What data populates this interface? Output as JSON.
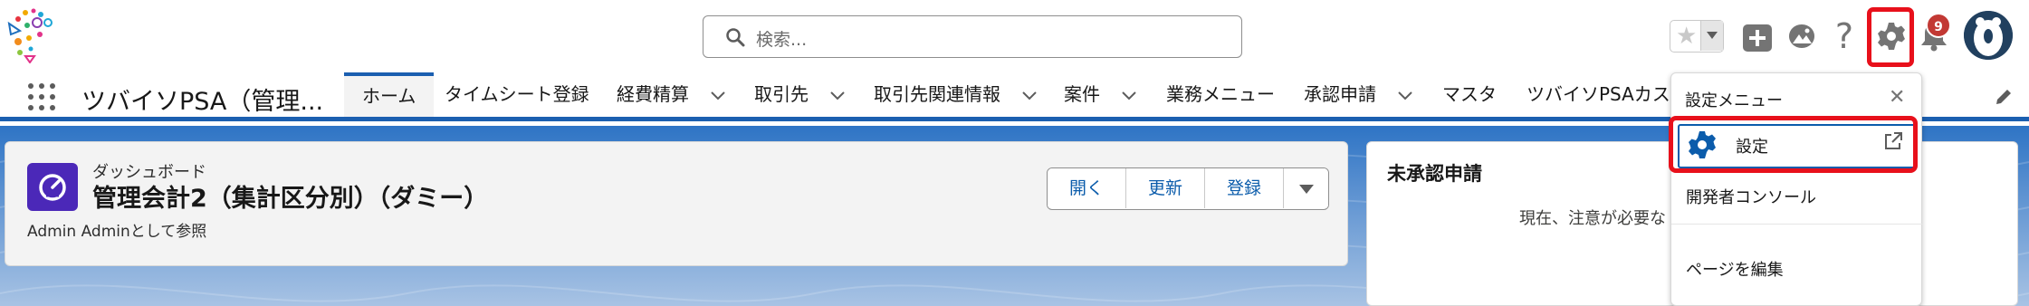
{
  "search": {
    "placeholder": "検索..."
  },
  "header": {
    "notifications_count": "9"
  },
  "nav": {
    "app_name": "ツバイソPSA（管理...",
    "tabs": [
      {
        "label": "ホーム",
        "active": true,
        "dropdown": false
      },
      {
        "label": "タイムシート登録",
        "dropdown": false
      },
      {
        "label": "経費精算",
        "dropdown": true
      },
      {
        "label": "取引先",
        "dropdown": true
      },
      {
        "label": "取引先関連情報",
        "dropdown": true
      },
      {
        "label": "案件",
        "dropdown": true
      },
      {
        "label": "業務メニュー",
        "dropdown": false
      },
      {
        "label": "承認申請",
        "dropdown": true
      },
      {
        "label": "マスタ",
        "dropdown": false
      },
      {
        "label": "ツバイソPSAカス",
        "dropdown": false
      }
    ]
  },
  "dashboard": {
    "type_label": "ダッシュボード",
    "title": "管理会計2（集計区分別）（ダミー）",
    "viewing_as": "Admin Adminとして参照",
    "buttons": {
      "open": "開く",
      "refresh": "更新",
      "register": "登録"
    }
  },
  "pending": {
    "title": "未承認申請",
    "message": "現在、注意が必要な"
  },
  "setup_menu": {
    "header": "設定メニュー",
    "items": {
      "setup": "設定",
      "developer_console": "開発者コンソール",
      "edit_page": "ページを編集"
    }
  },
  "colors": {
    "brand_blue": "#1b5fb0",
    "highlight_red": "#e8101b",
    "dashboard_icon": "#4b28b8",
    "link_blue": "#0b5cab"
  }
}
